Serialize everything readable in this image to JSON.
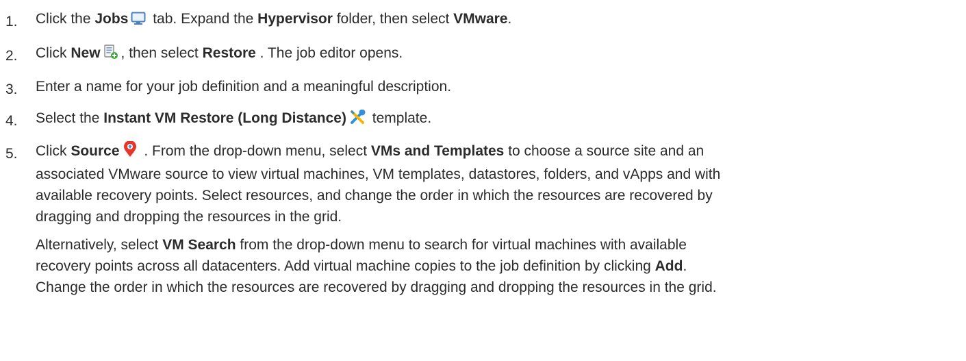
{
  "steps": [
    {
      "number": "1.",
      "parts": [
        "Click the ",
        "Jobs",
        " tab. Expand the ",
        "Hypervisor",
        " folder, then select ",
        "VMware",
        "."
      ]
    },
    {
      "number": "2.",
      "parts": [
        "Click ",
        "New",
        ", then select ",
        "Restore",
        " . The job editor opens."
      ]
    },
    {
      "number": "3.",
      "text": "Enter a name for your job definition and a meaningful description."
    },
    {
      "number": "4.",
      "parts": [
        "Select the ",
        "Instant VM Restore (Long Distance)",
        " template."
      ]
    },
    {
      "number": "5.",
      "line1": [
        "Click ",
        "Source",
        " . From the drop-down menu, select ",
        "VMs and Templates",
        " to choose a source site and an"
      ],
      "line2": "associated VMware source to view virtual machines, VM templates, datastores, folders, and vApps and with",
      "line3": "available recovery points. Select resources, and change the order in which the resources are recovered by",
      "line4": "dragging and dropping the resources in the grid.",
      "alt_line1": [
        "Alternatively, select ",
        "VM Search",
        " from the drop-down menu to search for virtual machines with available"
      ],
      "alt_line2": [
        "recovery points across all datacenters. Add virtual machine copies to the job definition by clicking ",
        "Add",
        "."
      ],
      "alt_line3": "Change the order in which the resources are recovered by dragging and dropping the resources in the grid."
    }
  ],
  "icons": {
    "jobs": "monitor-icon",
    "new": "new-job-icon",
    "template": "tools-icon",
    "source": "map-pin-icon"
  },
  "colors": {
    "text": "#2b2b2b",
    "monitor": "#4a7fc1",
    "tools_blue": "#2f8fd8",
    "tools_yellow": "#f2b705",
    "pin": "#e8342b",
    "new_green": "#3aa63a"
  }
}
